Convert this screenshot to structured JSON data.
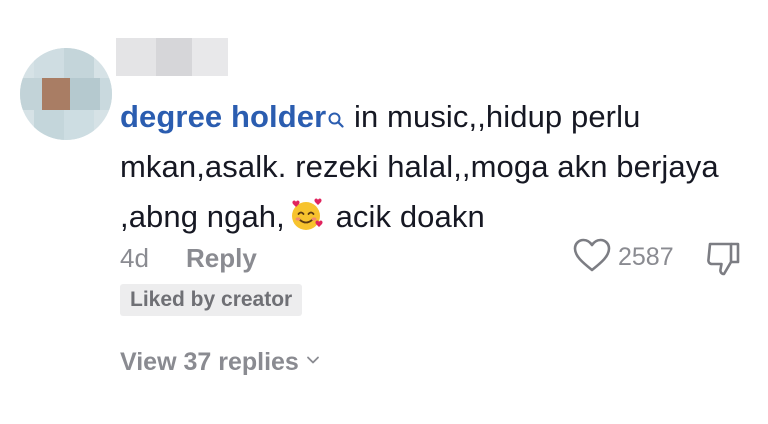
{
  "comment": {
    "author": "degree holder",
    "author_icon": "search-icon",
    "text_part1": " in music,,hidup perlu mkan,asalk. rezeki halal,,moga akn berjaya ,abng ngah,",
    "emoji": "smiling-face-with-hearts",
    "text_part2": " acik doakn",
    "timestamp": "4d",
    "reply_label": "Reply",
    "like_count": "2587",
    "badge": "Liked by creator",
    "view_replies_label": "View 37 replies"
  },
  "colors": {
    "author": "#2b5db0",
    "text": "#161823",
    "muted": "#8a8b91",
    "badge_bg": "#ededee"
  }
}
